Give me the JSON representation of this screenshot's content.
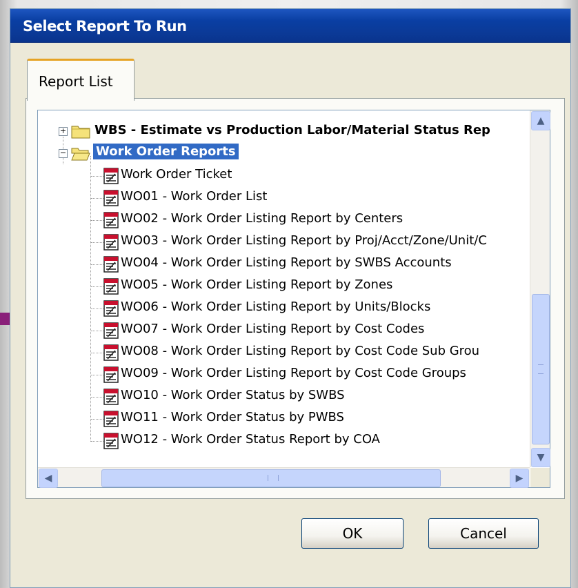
{
  "window": {
    "title": "Select Report To Run"
  },
  "tabs": [
    {
      "label": "Report List"
    }
  ],
  "tree": {
    "top_node": {
      "label": "WBS - Estimate vs Production Labor/Material Status Rep",
      "expander": "+"
    },
    "group_node": {
      "label": "Work Order Reports",
      "expander": "−"
    },
    "reports": [
      "Work Order Ticket",
      "WO01 - Work Order List",
      "WO02 - Work Order Listing Report by Centers",
      "WO03 - Work Order Listing Report by Proj/Acct/Zone/Unit/C",
      "WO04 - Work Order Listing Report by SWBS Accounts",
      "WO05 - Work Order Listing Report by Zones",
      "WO06 - Work Order Listing Report by Units/Blocks",
      "WO07 - Work Order Listing Report by Cost Codes",
      "WO08 - Work Order Listing Report by Cost Code Sub Grou",
      "WO09 - Work Order Listing Report by Cost Code Groups",
      "WO10 - Work Order Status by SWBS",
      "WO11 - Work Order Status by PWBS",
      "WO12 - Work Order Status Report by COA"
    ]
  },
  "buttons": {
    "ok": "OK",
    "cancel": "Cancel"
  },
  "icons": {
    "scroll_up": "▲",
    "scroll_down": "▼",
    "scroll_left": "◀",
    "scroll_right": "▶",
    "folder": "folder-icon",
    "report": "report-icon"
  },
  "colors": {
    "title_bar": "#0a3fa3",
    "selection": "#316ac5",
    "tab_accent": "#e6a323"
  }
}
